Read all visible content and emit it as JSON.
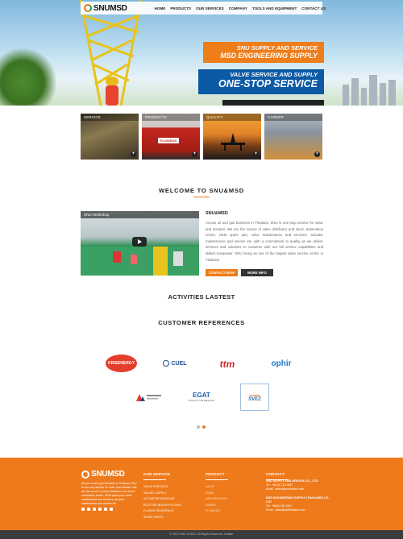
{
  "header": {
    "logo_text": "SNUMSD",
    "nav": [
      "HOME",
      "PRODUCTS",
      "OUR SERVICES",
      "COMPANY",
      "TOOLS AND EQUIPMENT",
      "CONTACT US"
    ]
  },
  "hero": {
    "banner1": {
      "line1": "SNU SUPPLY AND SERVICE",
      "line2": "MSD ENGINEERING SUPPLY"
    },
    "banner2": {
      "line1": "VALVE SERVICE AND SUPPLY",
      "line2": "ONE-STOP SERVICE"
    }
  },
  "tiles": [
    {
      "label": "SERVICE"
    },
    {
      "label": "PRODUCTS",
      "badge": "FLOWSUS"
    },
    {
      "label": "QUALITY"
    },
    {
      "label": "CAREER"
    }
  ],
  "welcome": {
    "title": "WELCOME TO SNU&MSD",
    "video_title": "SNU Workshop",
    "about_title": "SNU&MSD",
    "about_text": "Across oil and gas business in Thailand, SNU is one-stop service for valve and actuator. We are the source of valve distributor and stock, automation center, OEM spare part, valve maintenance and services, actuator maintenance and service etc. with a commitment to quality as we deliver services and solutions to customer with our full service capabilities and skilled manpower. SNU being as one of the largest valve service center in Thailand.",
    "btn_contact": "CONTACT NOW",
    "btn_more": "MORE INFO"
  },
  "activities": {
    "title": "ACTIVITIES LASTEST"
  },
  "customers": {
    "title": "CUSTOMER REFERENCES",
    "logos": [
      "KRISENERGY",
      "CUEL",
      "ttm",
      "ophir",
      "PTTEP",
      "EGAT",
      "SVEZ"
    ],
    "egat_sub": "Power for Thai Happiness",
    "svez_top": "Quality"
  },
  "footer": {
    "logo_text": "SNUMSD",
    "desc": "Across oil and gas business in Thailand, SNU is one-stop service for valve and actuator. We are the source of valve distributor and stock, automation center, OEM spare part, valve maintenance and services, actuator maintenance and service etc.",
    "services": {
      "title": "OUR SERVICE",
      "items": [
        "VALVE SERVICES",
        "VALVES SUPPLY",
        "ACTUATOR SERVICES",
        "ELECTRO BRUSH PLATING",
        "FLANGE RESURFACE",
        "SPARE PARTS"
      ]
    },
    "product": {
      "title": "PRODUCT",
      "items": [
        "VALVE",
        "ROSE",
        "NETHERLOCKS",
        "FIBREK",
        "FLOWSUS"
      ]
    },
    "contact": {
      "title": "CONTACT",
      "companies": [
        {
          "name": "SNU SUPPLY AND SERVICE CO., LTD",
          "tel": "Tel : +66 (2) 710-3097",
          "email": "Email : sales@snuthailand.com"
        },
        {
          "name": "MSD ENGINEERING SUPPLY (THAILAND) CO., LTD",
          "tel": "Tel : +66(2) 184 1547",
          "email": "Email : sales@msdthailand.com"
        }
      ]
    },
    "copyright": "© 2017 SNU & MSD. All Rights Reserved. Builder"
  },
  "colors": {
    "accent": "#ee7d1a",
    "blue": "#0c5aa5",
    "dark": "#333333"
  }
}
